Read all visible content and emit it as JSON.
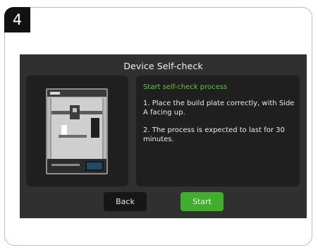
{
  "step": {
    "number": "4"
  },
  "screen": {
    "title": "Device Self-check",
    "printer_image": "3d-printer-photo",
    "info": {
      "heading": "Start self-check process",
      "line1": "1. Place the build plate correctly, with Side A facing up.",
      "line2": "2. The process is expected to last for 30 minutes."
    },
    "buttons": {
      "back_label": "Back",
      "start_label": "Start"
    }
  },
  "colors": {
    "screen_bg": "#303030",
    "panel_bg": "#1f1f1f",
    "accent_green": "#3fae2a",
    "heading_green": "#5fc83b",
    "badge_bg": "#111111"
  }
}
